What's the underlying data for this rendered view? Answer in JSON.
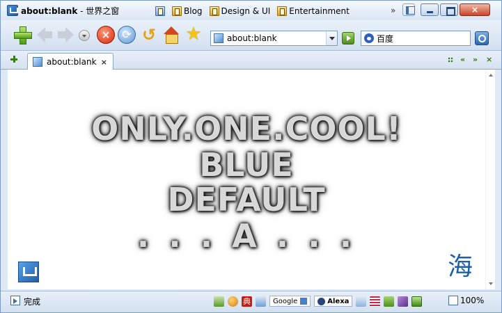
{
  "window": {
    "title_bold": "about:blank",
    "title_rest": " - 世界之窗"
  },
  "bookmarks": [
    {
      "label": "Blog"
    },
    {
      "label": "Design & UI"
    },
    {
      "label": "Entertainment"
    }
  ],
  "bookmarks_overflow": "»",
  "window_buttons": {
    "close_label": "×"
  },
  "toolbar": {
    "address_value": "about:blank",
    "search_value": "百度"
  },
  "tabs": [
    {
      "label": "about:blank",
      "close": "×"
    }
  ],
  "tab_controls": {
    "prev": "«",
    "next": "»",
    "close": "×"
  },
  "content": {
    "line1": "ONLY.ONE.COOL!",
    "line2": "BLUE",
    "line3": "DEFAULT",
    "line4": ". . . A . . .",
    "logo_right_glyph": "海"
  },
  "status": {
    "text": "完成",
    "google_label": "Google",
    "alexa_label": "Alexa",
    "badge_c": "典",
    "zoom": "100%"
  },
  "colors": {
    "frame": "#7a9ac7",
    "accent": "#1e5fab",
    "stop": "#d2250b",
    "go": "#4c8a1d"
  }
}
